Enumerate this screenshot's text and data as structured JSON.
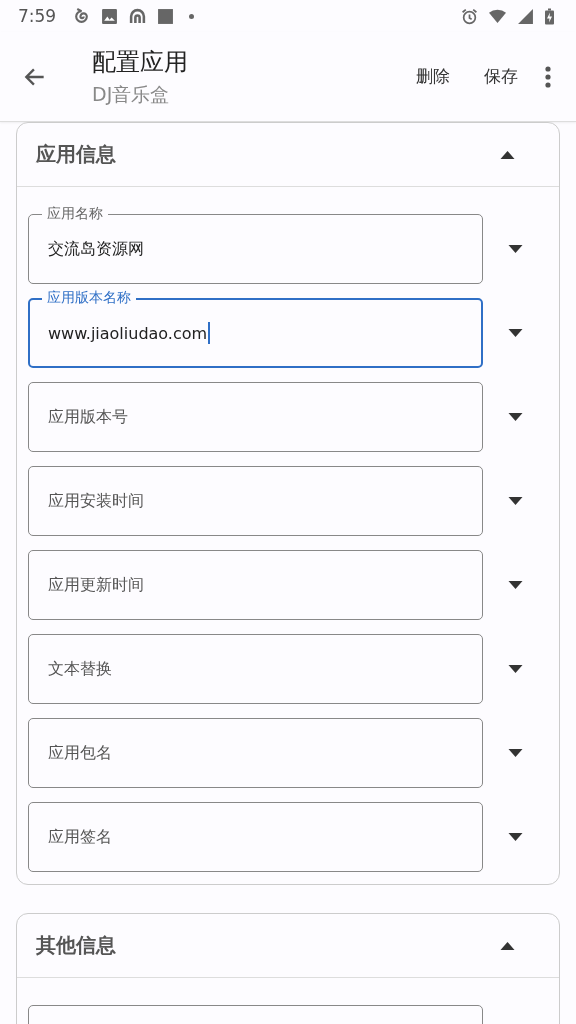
{
  "status_bar": {
    "time": "7:59"
  },
  "app_bar": {
    "title": "配置应用",
    "subtitle": "DJ音乐盒",
    "actions": [
      "删除",
      "保存"
    ]
  },
  "sections": [
    {
      "title": "应用信息",
      "expanded": true,
      "fields": [
        {
          "label": "应用名称",
          "value": "交流岛资源网",
          "focused": false
        },
        {
          "label": "应用版本名称",
          "value": "www.jiaoliudao.com",
          "focused": true
        },
        {
          "label": "应用版本号",
          "focused": false
        },
        {
          "label": "应用安装时间",
          "focused": false
        },
        {
          "label": "应用更新时间",
          "focused": false
        },
        {
          "label": "文本替换",
          "focused": false
        },
        {
          "label": "应用包名",
          "focused": false
        },
        {
          "label": "应用签名",
          "focused": false
        }
      ]
    },
    {
      "title": "其他信息",
      "expanded": true,
      "fields": [
        {
          "focused": false
        }
      ]
    }
  ]
}
